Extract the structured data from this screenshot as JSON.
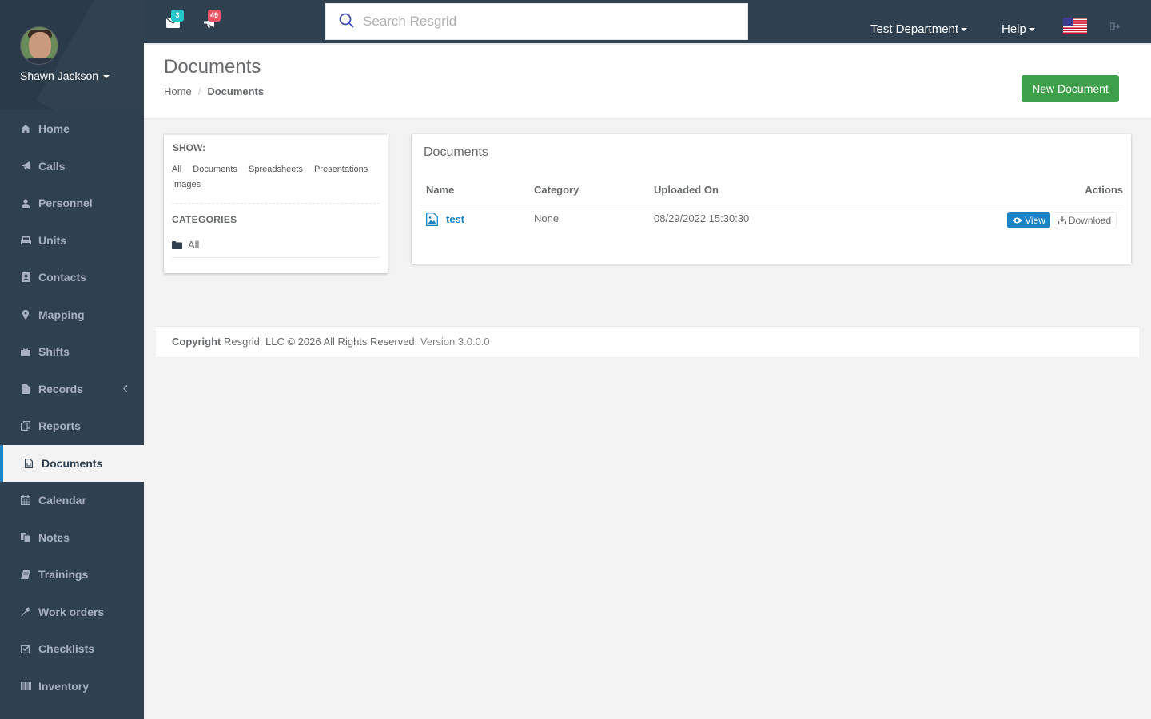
{
  "user": {
    "name": "Shawn Jackson"
  },
  "sidebar": {
    "items": [
      {
        "label": "Home",
        "icon": "home-icon"
      },
      {
        "label": "Calls",
        "icon": "bullhorn-icon"
      },
      {
        "label": "Personnel",
        "icon": "user-icon"
      },
      {
        "label": "Units",
        "icon": "truck-icon"
      },
      {
        "label": "Contacts",
        "icon": "contact-card-icon"
      },
      {
        "label": "Mapping",
        "icon": "map-marker-icon"
      },
      {
        "label": "Shifts",
        "icon": "briefcase-icon"
      },
      {
        "label": "Records",
        "icon": "file-icon"
      },
      {
        "label": "Reports",
        "icon": "copy-icon"
      },
      {
        "label": "Documents",
        "icon": "document-icon"
      },
      {
        "label": "Calendar",
        "icon": "calendar-icon"
      },
      {
        "label": "Notes",
        "icon": "notes-icon"
      },
      {
        "label": "Trainings",
        "icon": "book-icon"
      },
      {
        "label": "Work orders",
        "icon": "wrench-icon"
      },
      {
        "label": "Checklists",
        "icon": "checklist-icon"
      },
      {
        "label": "Inventory",
        "icon": "barcode-icon"
      }
    ],
    "active": "Documents"
  },
  "topbar": {
    "messages_count": "3",
    "calls_count": "49",
    "search_placeholder": "Search Resgrid",
    "department": "Test Department",
    "help": "Help"
  },
  "header": {
    "title": "Documents",
    "breadcrumb": [
      "Home",
      "Documents"
    ],
    "new_button": "New Document"
  },
  "filters": {
    "show_label": "SHOW:",
    "types": [
      "All",
      "Documents",
      "Spreadsheets",
      "Presentations",
      "Images"
    ],
    "categories_label": "CATEGORIES",
    "categories": [
      "All"
    ]
  },
  "documents": {
    "title": "Documents",
    "columns": [
      "Name",
      "Category",
      "Uploaded On",
      "Actions"
    ],
    "rows": [
      {
        "name": "test",
        "category": "None",
        "uploaded_on": "08/29/2022 15:30:30",
        "view": "View",
        "download": "Download"
      }
    ]
  },
  "footer": {
    "copyright_label": "Copyright",
    "copyright_text": "Resgrid, LLC © 2026 All Rights Reserved.",
    "version": "Version 3.0.0.0"
  },
  "colors": {
    "sidebar_bg": "#2f4050",
    "accent_blue": "#1c84c6",
    "success_green": "#3ea04a",
    "badge_teal": "#23c6c8",
    "badge_red": "#ed5565"
  }
}
